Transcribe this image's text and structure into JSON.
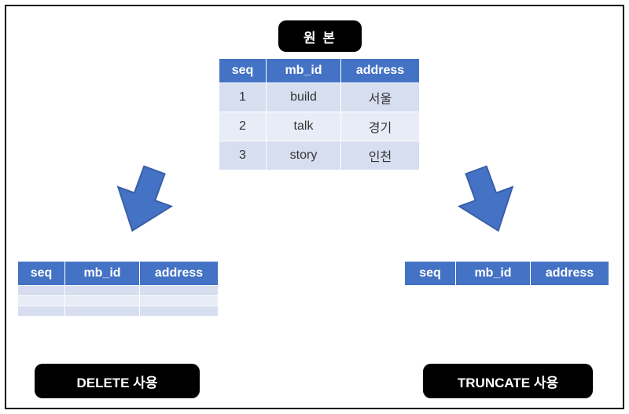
{
  "labels": {
    "original": "원 본",
    "delete": "DELETE 사용",
    "truncate": "TRUNCATE 사용"
  },
  "columns": [
    "seq",
    "mb_id",
    "address"
  ],
  "original_table": {
    "rows": [
      {
        "seq": "1",
        "mb_id": "build",
        "address": "서울"
      },
      {
        "seq": "2",
        "mb_id": "talk",
        "address": "경기"
      },
      {
        "seq": "3",
        "mb_id": "story",
        "address": "인천"
      }
    ]
  },
  "delete_table": {
    "rows": [
      {
        "seq": "",
        "mb_id": "",
        "address": ""
      },
      {
        "seq": "",
        "mb_id": "",
        "address": ""
      },
      {
        "seq": "",
        "mb_id": "",
        "address": ""
      }
    ]
  },
  "colors": {
    "header_bg": "#4472c4",
    "arrow_fill": "#4472c4",
    "arrow_stroke": "#3a5fa8"
  }
}
